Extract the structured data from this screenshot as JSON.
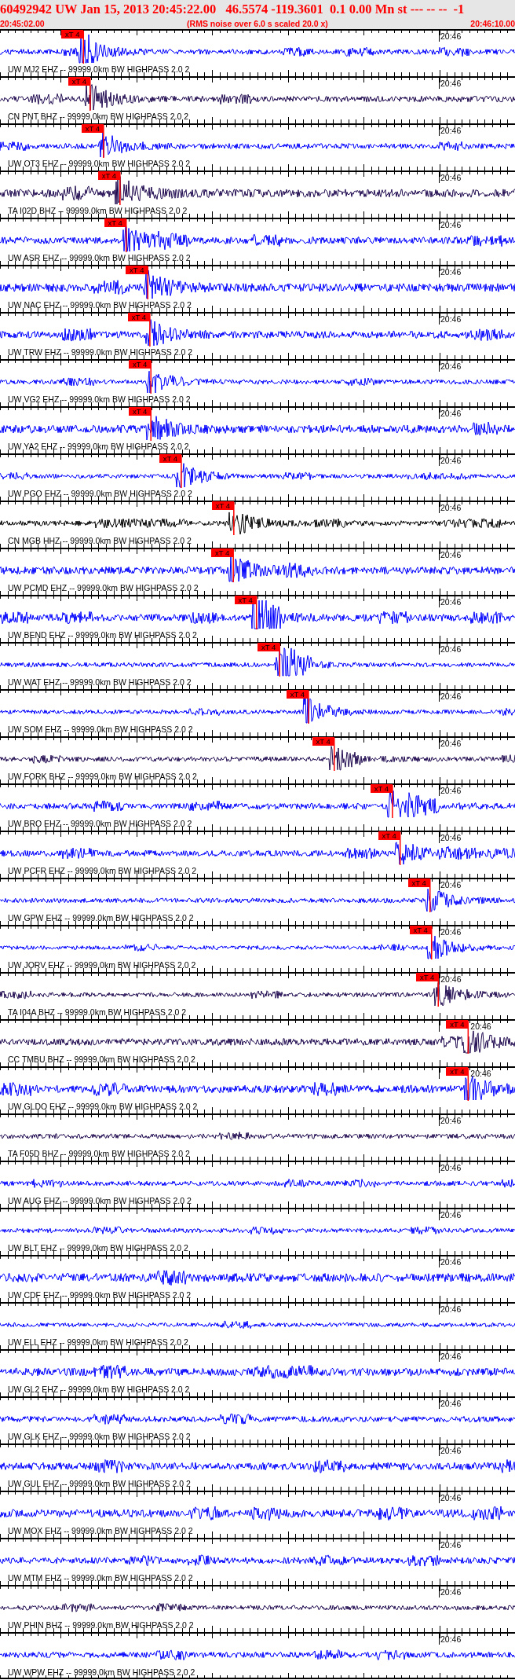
{
  "header": {
    "title": "60492942 UW Jan 15, 2013 20:45:22.00   46.5574 -119.3601  0.1 0.00 Mn st --- -- --  -1",
    "start_time": "20:45:02.00",
    "note": "(RMS noise over 6.0 s scaled 20.0 x)",
    "end_time": "20:46:10.00"
  },
  "traces": [
    {
      "label": "UW MJ2 EHZ -- 99999.0km BW HIGHPASS 2.0 2",
      "time_mark": "20:46",
      "color": "#0000ff",
      "pick": {
        "label": "xT 4",
        "level": 0.162
      }
    },
    {
      "label": "CN PNT BHZ -- 99999.0km BW HIGHPASS 2.0 2",
      "time_mark": "20:46",
      "color": "#200a50",
      "pick": {
        "label": "xT 4",
        "level": 0.175
      }
    },
    {
      "label": "UW OT3 EHZ -- 99999.0km BW HIGHPASS 2.0 2",
      "time_mark": "20:46",
      "color": "#0000ff",
      "pick": {
        "label": "xT 4",
        "level": 0.201
      }
    },
    {
      "label": "TA I02D BHZ -- 99999.0km BW HIGHPASS 2.0 2",
      "time_mark": "20:46",
      "color": "#200a50",
      "pick": {
        "label": "xT 4",
        "level": 0.233
      }
    },
    {
      "label": "UW ASR EHZ -- 99999.0km BW HIGHPASS 2.0 2",
      "time_mark": "20:46",
      "color": "#0000ff",
      "pick": {
        "label": "xT 4",
        "level": 0.245
      }
    },
    {
      "label": "UW NAC EHZ -- 99999.0km BW HIGHPASS 2.0 2",
      "time_mark": "20:46",
      "color": "#0000ff",
      "pick": {
        "label": "xT 4",
        "level": 0.287
      }
    },
    {
      "label": "UW TRW EHZ -- 99999.0km BW HIGHPASS 2.0 2",
      "time_mark": "20:46",
      "color": "#0000ff",
      "pick": {
        "label": "xT 4",
        "level": 0.291
      }
    },
    {
      "label": "UW VG2 EHZ -- 99999.0km BW HIGHPASS 2.0 2",
      "time_mark": "20:46",
      "color": "#0000ff",
      "pick": {
        "label": "xT 4",
        "level": 0.293
      }
    },
    {
      "label": "UW YA2 EHZ -- 99999.0km BW HIGHPASS 2.0 2",
      "time_mark": "20:46",
      "color": "#0000ff",
      "pick": {
        "label": "xT 4",
        "level": 0.293
      }
    },
    {
      "label": "UW PGO EHZ -- 99999.0km BW HIGHPASS 2.0 2",
      "time_mark": "20:46",
      "color": "#0000ff",
      "pick": {
        "label": "xT 4",
        "level": 0.352
      }
    },
    {
      "label": "CN MGB HHZ -- 99999.0km BW HIGHPASS 2.0 2",
      "time_mark": "20:46",
      "color": "#000000",
      "pick": {
        "label": "xT 4",
        "level": 0.454
      }
    },
    {
      "label": "UW PCMD EHZ -- 99999.0km BW HIGHPASS 2.0 2",
      "time_mark": "20:46",
      "color": "#0000ff",
      "pick": {
        "label": "xT 4",
        "level": 0.453
      }
    },
    {
      "label": "UW BEND EHZ -- 99999.0km BW HIGHPASS 2.0 2",
      "time_mark": "20:46",
      "color": "#0000ff",
      "pick": {
        "label": "xT 4",
        "level": 0.498
      }
    },
    {
      "label": "UW WAT EHZ -- 99999.0km BW HIGHPASS 2.0 2",
      "time_mark": "20:46",
      "color": "#0000ff",
      "pick": {
        "label": "xT 4",
        "level": 0.543
      }
    },
    {
      "label": "UW SOM EHZ -- 99999.0km BW HIGHPASS 2.0 2",
      "time_mark": "20:46",
      "color": "#0000ff",
      "pick": {
        "label": "xT 4",
        "level": 0.599
      }
    },
    {
      "label": "UW FORK BHZ -- 99999.0km BW HIGHPASS 2.0 2",
      "time_mark": "20:46",
      "color": "#200a50",
      "pick": {
        "label": "xT 4",
        "level": 0.649
      }
    },
    {
      "label": "UW BRO EHZ -- 99999.0km BW HIGHPASS 2.0 2",
      "time_mark": "20:46",
      "color": "#0000ff",
      "pick": {
        "label": "xT 4",
        "level": 0.762
      }
    },
    {
      "label": "UW PCFR EHZ -- 99999.0km BW HIGHPASS 2.0 2",
      "time_mark": "20:46",
      "color": "#0000ff",
      "pick": {
        "label": "xT 4",
        "level": 0.777
      }
    },
    {
      "label": "UW GPW EHZ -- 99999.0km BW HIGHPASS 2.0 2",
      "time_mark": "20:46",
      "color": "#0000ff",
      "pick": {
        "label": "xT 4",
        "level": 0.835
      }
    },
    {
      "label": "UW JORV EHZ -- 99999.0km BW HIGHPASS 2.0 2",
      "time_mark": "20:46",
      "color": "#0000ff",
      "pick": {
        "label": "xT 4",
        "level": 0.838
      }
    },
    {
      "label": "TA I04A BHZ -- 99999.0km BW HIGHPASS 2.0 2",
      "time_mark": "20:46",
      "color": "#200a50",
      "pick": {
        "label": "xT 4",
        "level": 0.851
      }
    },
    {
      "label": "CC TMBU BHZ -- 99999.0km BW HIGHPASS 2.0 2",
      "time_mark": "20:46",
      "color": "#200a50",
      "pick": {
        "label": "xT 4",
        "level": 0.909
      }
    },
    {
      "label": "UW GLDO EHZ -- 99999.0km BW HIGHPASS 2.0 2",
      "time_mark": "20:46",
      "color": "#0000ff",
      "pick": {
        "label": "xT 4",
        "level": 0.909
      }
    },
    {
      "label": "TA F05D BHZ -- 99999.0km BW HIGHPASS 2.0 2",
      "time_mark": "20:46",
      "color": "#200a50"
    },
    {
      "label": "UW AUG EHZ -- 99999.0km BW HIGHPASS 2.0 2",
      "time_mark": "20:46",
      "color": "#0000ff"
    },
    {
      "label": "UW BLT EHZ -- 99999.0km BW HIGHPASS 2.0 2",
      "time_mark": "20:46",
      "color": "#0000ff"
    },
    {
      "label": "UW CDF EHZ -- 99999.0km BW HIGHPASS 2.0 2",
      "time_mark": "20:46",
      "color": "#0000ff"
    },
    {
      "label": "UW ELL EHZ -- 99999.0km BW HIGHPASS 2.0 2",
      "time_mark": "20:46",
      "color": "#0000ff"
    },
    {
      "label": "UW GL2 EHZ -- 99999.0km BW HIGHPASS 2.0 2",
      "time_mark": "20:46",
      "color": "#0000ff"
    },
    {
      "label": "UW GLK EHZ -- 99999.0km BW HIGHPASS 2.0 2",
      "time_mark": "20:46",
      "color": "#0000ff"
    },
    {
      "label": "UW GUL EHZ -- 99999.0km BW HIGHPASS 2.0 2",
      "time_mark": "20:46",
      "color": "#0000ff"
    },
    {
      "label": "UW MOX EHZ -- 99999.0km BW HIGHPASS 2.0 2",
      "time_mark": "20:46",
      "color": "#0000ff"
    },
    {
      "label": "UW MTM EHZ -- 99999.0km BW HIGHPASS 2.0 2",
      "time_mark": "20:46",
      "color": "#0000ff"
    },
    {
      "label": "UW PHIN BHZ -- 99999.0km BW HIGHPASS 2.0 2",
      "time_mark": "20:46",
      "color": "#200a50"
    },
    {
      "label": "UW WPW EHZ -- 99999.0km BW HIGHPASS 2.0 2",
      "time_mark": "20:46",
      "color": "#0000ff"
    }
  ]
}
